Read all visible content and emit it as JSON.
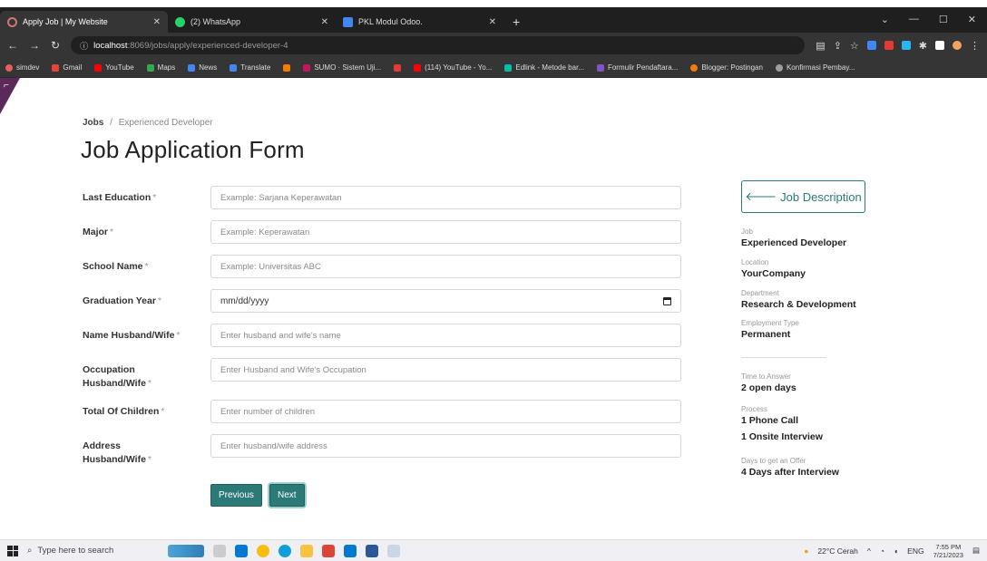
{
  "browser": {
    "tabs": [
      {
        "label": "Apply Job | My Website",
        "color": "#ffffff",
        "active": true
      },
      {
        "label": "(2) WhatsApp",
        "color": "#25d366",
        "active": false
      },
      {
        "label": "PKL Modul Odoo.",
        "color": "#4285f4",
        "active": false
      }
    ],
    "url_host": "localhost",
    "url_path": ":8069/jobs/apply/experienced-developer-4",
    "bookmarks": [
      {
        "label": "simdev",
        "color": "#e85d5d"
      },
      {
        "label": "Gmail",
        "color": "#ea4335"
      },
      {
        "label": "YouTube",
        "color": "#ff0000"
      },
      {
        "label": "Maps",
        "color": "#34a853"
      },
      {
        "label": "News",
        "color": "#4285f4"
      },
      {
        "label": "Translate",
        "color": "#4285f4"
      },
      {
        "label": "",
        "color": "#f57c00"
      },
      {
        "label": "SUMO · Sistem Uji...",
        "color": "#c2185b"
      },
      {
        "label": "",
        "color": "#e53935"
      },
      {
        "label": "(114) YouTube - Yo...",
        "color": "#ff0000"
      },
      {
        "label": "Edlink - Metode bar...",
        "color": "#00bfa5"
      },
      {
        "label": "Formulir Pendaftara...",
        "color": "#7e57c2"
      },
      {
        "label": "Blogger: Postingan",
        "color": "#f57c00"
      },
      {
        "label": "Konfirmasi Pembay...",
        "color": "#9e9e9e"
      }
    ]
  },
  "breadcrumb": {
    "root": "Jobs",
    "separator": "/",
    "current": "Experienced Developer"
  },
  "page_title": "Job Application Form",
  "form": {
    "last_education": {
      "label": "Last Education",
      "placeholder": "Example: Sarjana Keperawatan"
    },
    "major": {
      "label": "Major",
      "placeholder": "Example: Keperawatan"
    },
    "school_name": {
      "label": "School Name",
      "placeholder": "Example: Universitas ABC"
    },
    "graduation_year": {
      "label": "Graduation Year",
      "value": "mm/dd/yyyy"
    },
    "spouse_name": {
      "label": "Name Husband/Wife",
      "placeholder": "Enter husband and wife's name"
    },
    "spouse_occupation": {
      "label": "Occupation Husband/Wife",
      "placeholder": "Enter Husband and Wife's Occupation"
    },
    "total_children": {
      "label": "Total Of Children",
      "placeholder": "Enter number of children"
    },
    "spouse_address": {
      "label": "Address Husband/Wife",
      "placeholder": "Enter husband/wife address"
    },
    "required_mark": "*",
    "previous_label": "Previous",
    "next_label": "Next"
  },
  "sidebar": {
    "job_description_label": "Job Description",
    "job_label": "Job",
    "job_value": "Experienced Developer",
    "location_label": "Location",
    "location_value": "YourCompany",
    "department_label": "Department",
    "department_value": "Research & Development",
    "employment_label": "Employment Type",
    "employment_value": "Permanent",
    "time_label": "Time to Answer",
    "time_value": "2 open days",
    "process_label": "Process",
    "process_step1": "1 Phone Call",
    "process_step2": "1 Onsite Interview",
    "offer_label": "Days to get an Offer",
    "offer_value": "4 Days after Interview"
  },
  "taskbar": {
    "search_placeholder": "Type here to search",
    "weather": "22°C Cerah",
    "language": "ENG",
    "time": "7:55 PM",
    "date": "7/21/2023"
  },
  "colors": {
    "accent": "#2b7a78",
    "corner": "#5b2a5a"
  }
}
